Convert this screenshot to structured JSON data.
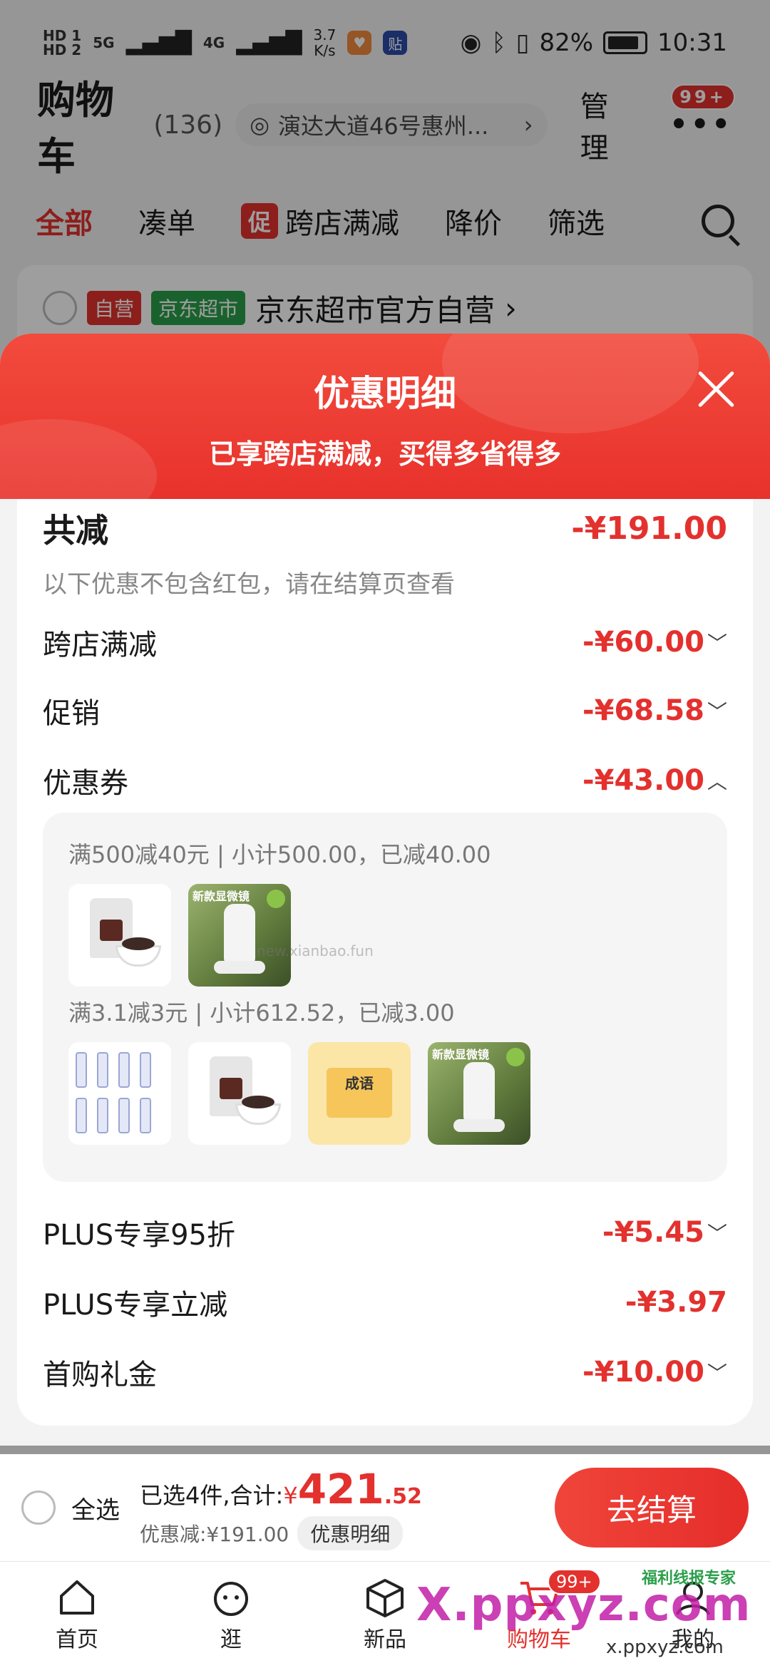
{
  "status": {
    "net1": "HD 1",
    "net2": "HD 2",
    "sig1": "5G",
    "sig2": "4G",
    "speed_value": "3.7",
    "speed_unit": "K/s",
    "battery": "82%",
    "time": "10:31"
  },
  "header": {
    "title": "购物车",
    "count": "(136)",
    "address": "演达大道46号惠州...",
    "manage": "管理",
    "more_badge": "99+"
  },
  "tabs": [
    {
      "label": "全部"
    },
    {
      "label": "凑单"
    },
    {
      "chip": "促",
      "label": "跨店满减"
    },
    {
      "label": "降价"
    },
    {
      "label": "筛选"
    }
  ],
  "shop": {
    "tag1": "自营",
    "tag2": "京东超市",
    "name": "京东超市官方自营",
    "arrow": "›"
  },
  "sheet": {
    "title": "优惠明细",
    "subtitle": "已享跨店满减，买得多省得多",
    "total_label": "共减",
    "total_amount": "-¥191.00",
    "note": "以下优惠不包含红包，请在结算页查看",
    "rows": [
      {
        "label": "跨店满减",
        "amount": "-¥60.00",
        "chev": "﹀"
      },
      {
        "label": "促销",
        "amount": "-¥68.58",
        "chev": "﹀"
      },
      {
        "label": "优惠券",
        "amount": "-¥43.00",
        "chev": "︿"
      }
    ],
    "coupon_lines": [
      "满500减40元 | 小计500.00，已减40.00",
      "满3.1减3元 | 小计612.52，已减3.00"
    ],
    "watermark": "new.xianbao.fun",
    "scope_label": "新款显微镜",
    "book_label": "成语",
    "rows2": [
      {
        "label": "PLUS专享95折",
        "amount": "-¥5.45",
        "chev": "﹀"
      },
      {
        "label": "PLUS专享立减",
        "amount": "-¥3.97",
        "chev": ""
      },
      {
        "label": "首购礼金",
        "amount": "-¥10.00",
        "chev": "﹀"
      }
    ]
  },
  "bottom": {
    "select_all": "全选",
    "selected_text": "已选4件,合计:",
    "yen": "¥",
    "price_int": "421",
    "price_dec": ".52",
    "discount_text": "优惠减:¥191.00",
    "detail_chip": "优惠明细",
    "checkout": "去结算"
  },
  "nav": [
    {
      "label": "首页",
      "icon": "home-icon"
    },
    {
      "label": "逛",
      "icon": "browse-icon"
    },
    {
      "label": "新品",
      "icon": "new-product-icon"
    },
    {
      "label": "购物车",
      "icon": "cart-icon",
      "badge": "99+"
    },
    {
      "label": "我的",
      "icon": "profile-icon"
    }
  ],
  "watermarks": {
    "big": "X.ppxyz.com",
    "small": "x.ppxyz.com",
    "green": "福利线报专家"
  },
  "colors": {
    "accent": "#e3312e",
    "green": "#2b9f4a"
  }
}
